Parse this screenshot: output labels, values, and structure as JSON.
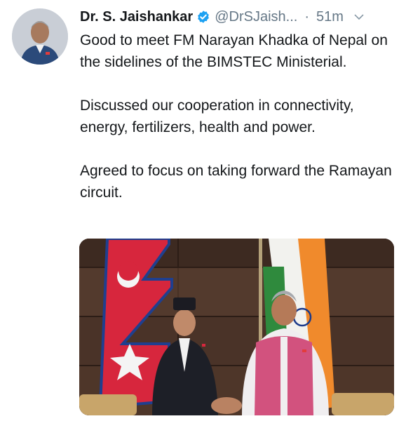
{
  "tweet": {
    "author_name": "Dr. S. Jaishankar",
    "handle": "@DrSJaish...",
    "separator": "·",
    "time_ago": "51m",
    "paragraphs": [
      "Good to meet FM Narayan Khadka of Nepal on the sidelines of the BIMSTEC Ministerial.",
      "Discussed our cooperation in connectivity, energy, fertilizers, health and power.",
      "Agreed to focus on taking forward the Ramayan circuit."
    ]
  },
  "icons": {
    "verified": "verified-badge-icon",
    "menu": "chevron-down-icon"
  },
  "colors": {
    "verified_blue": "#1da1f2",
    "secondary_text": "#657786",
    "primary_text": "#14171a"
  }
}
